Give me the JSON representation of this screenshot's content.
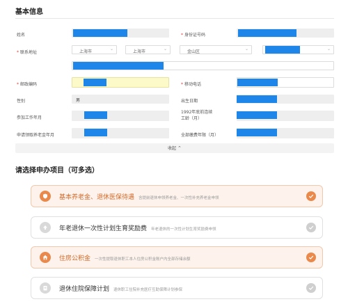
{
  "basic": {
    "title": "基本信息",
    "name_label": "姓名",
    "id_label": "身份证号码",
    "address_label": "联系地址",
    "province": "上海市",
    "city": "上海市",
    "district": "金山区",
    "postcode_label": "邮政编码",
    "mobile_label": "移动电话",
    "gender_label": "性别",
    "gender_value": "男",
    "birth_label": "出生日期",
    "work_date_label": "参加工作年月",
    "continuous_label_1": "1992年底前连续",
    "continuous_label_2": "工龄（月）",
    "pension_date_label": "申请领取养老金年月",
    "total_months_label": "全部缴费年限（月）",
    "collapse_label": "收起",
    "collapse_icon": "chevron-up"
  },
  "apply": {
    "title": "请选择申办项目（可多选）",
    "items": [
      {
        "main": "基本养老金、退休医保待遇",
        "sub": "含提前退休申领养老金、一次性补充养老金申领",
        "selected": true,
        "icon": "shield-icon"
      },
      {
        "main": "年老退休一次性计划生育奖励费",
        "sub": "年老退休的一次性计划生育奖励费申领",
        "selected": false,
        "icon": "arrow-up-icon"
      },
      {
        "main": "住房公积金",
        "sub": "一次性提取退休职工本人住房公积金账户内全部存储余额",
        "selected": true,
        "icon": "house-icon"
      },
      {
        "main": "退休住院保障计划",
        "sub": "退休职工住院补充医疗互助保障计划参保",
        "selected": false,
        "icon": "hospital-icon"
      }
    ]
  },
  "colors": {
    "accent": "#e98a4c",
    "redaction": "#1e86e8",
    "highlight": "#fbfac8"
  }
}
